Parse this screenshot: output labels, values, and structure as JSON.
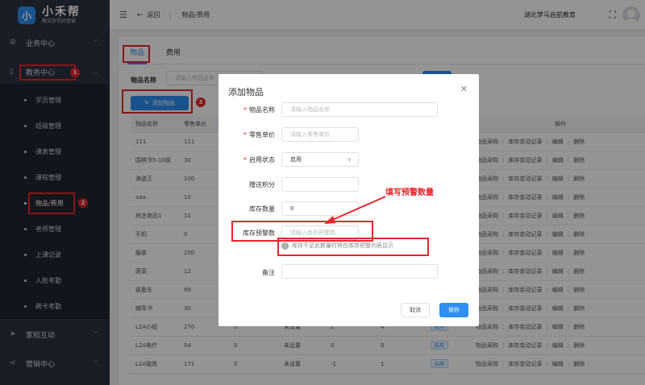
{
  "app": {
    "logo_mark": "小",
    "title": "小禾帮",
    "subtitle": "教培办学好管家"
  },
  "sidebar": {
    "groups": [
      {
        "label": "业务中心",
        "icon": "settings-icon"
      },
      {
        "label": "教务中心",
        "icon": "book-icon"
      },
      {
        "label": "家校互动",
        "icon": "send-icon"
      },
      {
        "label": "营销中心",
        "icon": "share-icon"
      }
    ],
    "items": [
      {
        "label": "学员管理"
      },
      {
        "label": "班级管理"
      },
      {
        "label": "课表管理"
      },
      {
        "label": "课程管理"
      },
      {
        "label": "物品/费用"
      },
      {
        "label": "老师管理"
      },
      {
        "label": "上课记录"
      },
      {
        "label": "人脸考勤"
      },
      {
        "label": "刷卡考勤"
      }
    ]
  },
  "header": {
    "back": "返回",
    "breadcrumb": "物品/费用",
    "school": "湖北梦马启航教育"
  },
  "tabs": [
    {
      "label": "物品"
    },
    {
      "label": "费用"
    }
  ],
  "filter": {
    "label": "物品名称",
    "placeholder": "请输入物品名称"
  },
  "add_button": "添加物品",
  "annotation_numbers": {
    "one": "1",
    "two": "2",
    "three": "3"
  },
  "table": {
    "headers": [
      "物品名称",
      "零售单价",
      "",
      "",
      "",
      "",
      "",
      "",
      "操作"
    ],
    "op_labels": [
      "物品采购",
      "库存变动记录",
      "编辑",
      "删除"
    ],
    "rows": [
      {
        "name": "111",
        "price": "111",
        "c3": "",
        "c4": "",
        "c5": "",
        "c6": "",
        "c7": ""
      },
      {
        "name": "围棋书5-10级",
        "price": "30",
        "c3": "",
        "c4": "",
        "c5": "",
        "c6": "",
        "c7": ""
      },
      {
        "name": "海盗王",
        "price": "100",
        "c3": "",
        "c4": "",
        "c5": "",
        "c6": "",
        "c7": ""
      },
      {
        "name": "aaa",
        "price": "10",
        "c3": "",
        "c4": "",
        "c5": "",
        "c6": "",
        "c7": ""
      },
      {
        "name": "林芝商品1",
        "price": "11",
        "c3": "",
        "c4": "",
        "c5": "",
        "c6": "",
        "c7": ""
      },
      {
        "name": "手机",
        "price": "0",
        "c3": "",
        "c4": "",
        "c5": "",
        "c6": "",
        "c7": ""
      },
      {
        "name": "服装",
        "price": "200",
        "c3": "",
        "c4": "",
        "c5": "",
        "c6": "",
        "c7": ""
      },
      {
        "name": "蔬菜",
        "price": "12",
        "c3": "",
        "c4": "",
        "c5": "",
        "c6": "",
        "c7": ""
      },
      {
        "name": "装备车",
        "price": "99",
        "c3": "",
        "c4": "",
        "c5": "",
        "c6": "",
        "c7": ""
      },
      {
        "name": "辅导书",
        "price": "30",
        "c3": "",
        "c4": "",
        "c5": "",
        "c6": "",
        "c7": ""
      },
      {
        "name": "L2A小组",
        "price": "270",
        "c3": "0",
        "c4": "未设置",
        "c5": "2",
        "c6": "4",
        "c7": "启用"
      },
      {
        "name": "L2A电疗",
        "price": "54",
        "c3": "0",
        "c4": "未设置",
        "c5": "0",
        "c6": "0",
        "c7": "启用"
      },
      {
        "name": "L2A锻炼",
        "price": "171",
        "c3": "0",
        "c4": "未设置",
        "c5": "-1",
        "c6": "1",
        "c7": "启用"
      }
    ]
  },
  "dialog": {
    "title": "添加物品",
    "fields": {
      "name": {
        "label": "物品名称",
        "placeholder": "请输入物品名称"
      },
      "price": {
        "label": "零售单价",
        "placeholder": "请输入零售单价"
      },
      "status": {
        "label": "启用状态",
        "value": "启用"
      },
      "points": {
        "label": "赠送积分"
      },
      "stock": {
        "label": "库存数量",
        "value": "0"
      },
      "warn": {
        "label": "库存预警数",
        "placeholder": "请输入库存预警数"
      },
      "remark": {
        "label": "备注"
      }
    },
    "hint": "库存不足此数量时将在库存预警列表显示",
    "cancel": "取消",
    "save": "保存"
  },
  "annotation": "填写预警数量",
  "colors": {
    "accent": "#2e8ff0",
    "annotation_red": "#e8262b",
    "sidebar_bg": "#2b3240"
  }
}
